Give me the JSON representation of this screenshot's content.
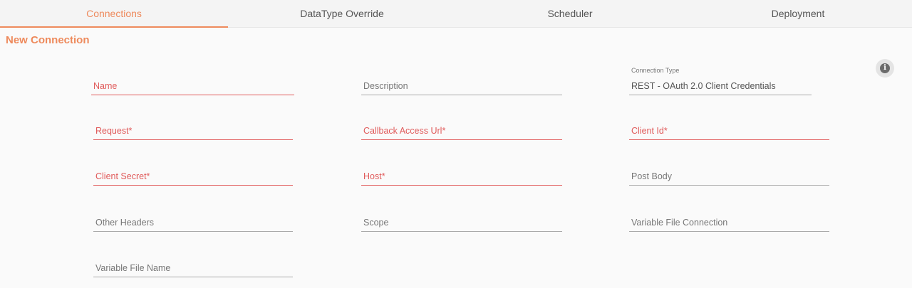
{
  "tabs": [
    {
      "label": "Connections",
      "active": true
    },
    {
      "label": "DataType Override",
      "active": false
    },
    {
      "label": "Scheduler",
      "active": false
    },
    {
      "label": "Deployment",
      "active": false
    }
  ],
  "section_title": "New Connection",
  "info_icon": "info-icon",
  "fields": {
    "name": {
      "placeholder": "Name"
    },
    "description": {
      "placeholder": "Description"
    },
    "connection_type": {
      "label": "Connection Type",
      "value": "REST - OAuth 2.0 Client Credentials"
    },
    "request": {
      "placeholder": "Request*"
    },
    "callback_access_url": {
      "placeholder": "Callback Access Url*"
    },
    "client_id": {
      "placeholder": "Client Id*"
    },
    "client_secret": {
      "placeholder": "Client Secret*"
    },
    "host": {
      "placeholder": "Host*"
    },
    "post_body": {
      "placeholder": "Post Body"
    },
    "other_headers": {
      "placeholder": "Other Headers"
    },
    "scope": {
      "placeholder": "Scope"
    },
    "variable_file_connection": {
      "placeholder": "Variable File Connection"
    },
    "variable_file_name": {
      "placeholder": "Variable File Name"
    }
  },
  "colors": {
    "accent": "#ee8a5c",
    "error": "#e05a5a",
    "text_muted": "#777777"
  }
}
